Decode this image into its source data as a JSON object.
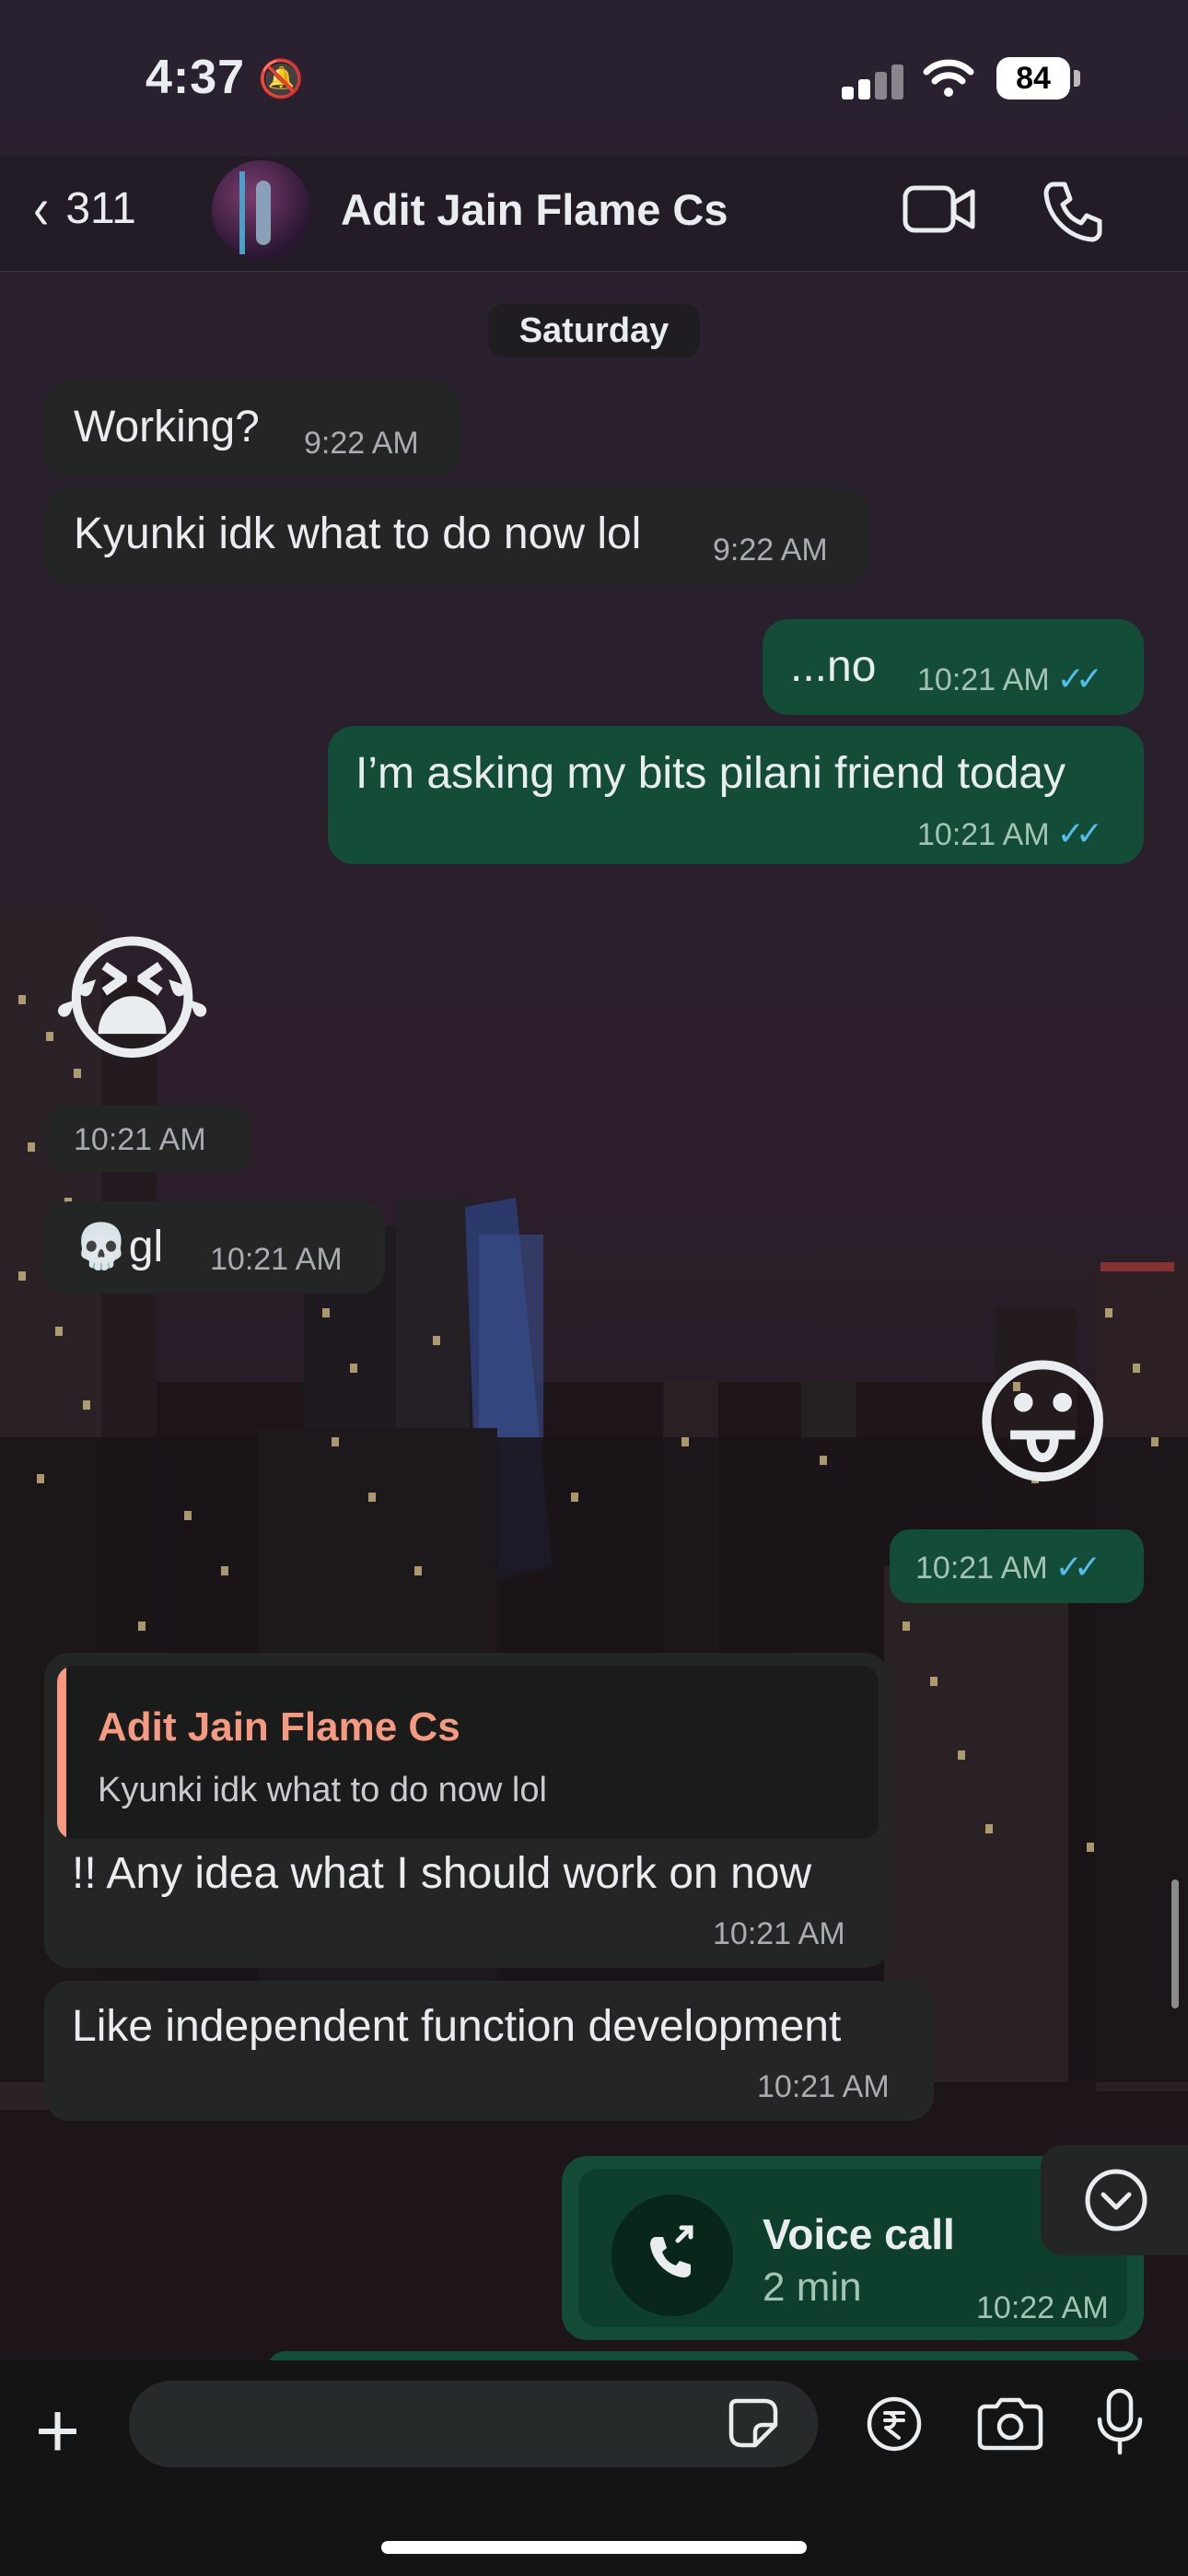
{
  "status_bar": {
    "time": "4:37",
    "battery": "84"
  },
  "header": {
    "back_count": "311",
    "contact_name": "Adit Jain Flame Cs"
  },
  "date_chip": "Saturday",
  "messages": [
    {
      "dir": "in",
      "text": "Working?",
      "time": "9:22 AM"
    },
    {
      "dir": "in",
      "text": "Kyunki idk what to do now lol",
      "time": "9:22 AM"
    },
    {
      "dir": "out",
      "text": "...no",
      "time": "10:21 AM"
    },
    {
      "dir": "out",
      "text": "I’m asking my bits pilani friend today",
      "time": "10:21 AM"
    },
    {
      "dir": "in",
      "text": "😭",
      "time": "10:21 AM"
    },
    {
      "dir": "in",
      "text": "💀gl",
      "time": "10:21 AM"
    },
    {
      "dir": "out",
      "text": "😛",
      "time": "10:21 AM"
    },
    {
      "dir": "in",
      "reply_to_name": "Adit Jain Flame Cs",
      "reply_to_text": "Kyunki idk what to do now lol",
      "text": "!! Any idea what I should work on now",
      "time": "10:21 AM"
    },
    {
      "dir": "in",
      "text": "Like independent function development",
      "time": "10:21 AM"
    }
  ],
  "voice_call": {
    "title": "Voice call",
    "duration": "2 min",
    "time": "10:22 AM"
  },
  "read_ticks": "✓✓",
  "icons": {
    "back": "chevron-left-icon",
    "mute": "bell-slash-icon",
    "video": "video-camera-icon",
    "call": "phone-icon",
    "add": "plus-icon",
    "sticker": "sticker-icon",
    "payment": "rupee-icon",
    "camera": "camera-icon",
    "mic": "microphone-icon",
    "scroll": "chevron-down-circle-icon"
  },
  "colors": {
    "incoming": "#242626",
    "outgoing": "#144d37",
    "read_ticks": "#53bdeb",
    "quote_accent": "#f59a80"
  }
}
